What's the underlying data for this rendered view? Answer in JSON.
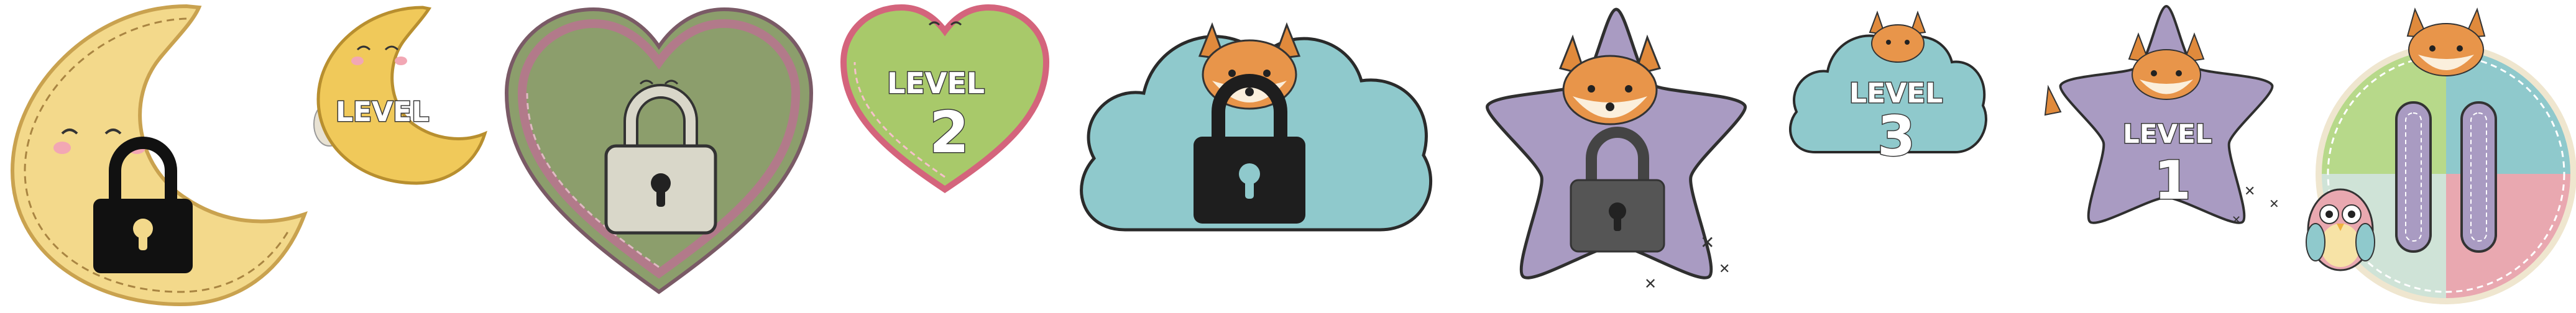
{
  "sprite_sheet": {
    "tiles": [
      {
        "id": "moon-locked",
        "state": "locked",
        "shape": "crescent-moon",
        "fill": "#f3d98b",
        "lock_color": "#111111"
      },
      {
        "id": "moon-level",
        "state": "unlocked",
        "shape": "crescent-moon",
        "label": "LEVEL",
        "number": "",
        "fill": "#f0c95a"
      },
      {
        "id": "heart-locked",
        "state": "locked",
        "shape": "heart",
        "fill": "#8c9e6c",
        "border": "#b27a8a",
        "lock_color": "#d9d7c9"
      },
      {
        "id": "heart-level-2",
        "state": "unlocked",
        "shape": "heart",
        "label": "LEVEL",
        "number": "2",
        "fill": "#a8c96a",
        "border": "#e48a9e"
      },
      {
        "id": "cloud-locked",
        "state": "locked",
        "shape": "cloud",
        "fill": "#8fc9cc",
        "lock_color": "#1e1e1e",
        "character": "fox"
      },
      {
        "id": "star-locked",
        "state": "locked",
        "shape": "star",
        "fill": "#a99bc2",
        "lock_color": "#555555",
        "character": "fox"
      },
      {
        "id": "cloud-level-3",
        "state": "unlocked",
        "shape": "cloud",
        "label": "LEVEL",
        "number": "3",
        "fill": "#8fc9cc",
        "character": "fox"
      },
      {
        "id": "star-level-1",
        "state": "unlocked",
        "shape": "star",
        "label": "LEVEL",
        "number": "1",
        "fill": "#a99bc2",
        "character": "fox"
      },
      {
        "id": "pause-button",
        "state": "button",
        "shape": "patchwork-circle",
        "character": "fox+owl",
        "colors": [
          "#b7d98a",
          "#8fc9cc",
          "#e9a8b0",
          "#cfe3d7"
        ],
        "pause_bar_color": "#a99bc2"
      }
    ]
  }
}
